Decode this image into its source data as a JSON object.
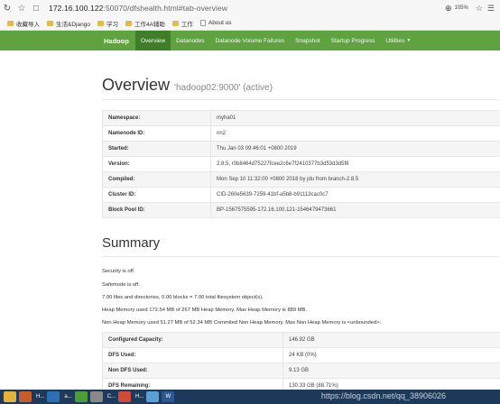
{
  "browser": {
    "url_host": "172.16.100.122",
    "url_rest": ":50070/dfshealth.html#tab-overview",
    "zoom": "105%"
  },
  "bookmarks": [
    "收藏导入",
    "生活&Django",
    "学习",
    "工作4A辅助",
    "工作",
    "About us"
  ],
  "navbar": {
    "brand": "Hadoop",
    "items": [
      "Overview",
      "Datanodes",
      "Datanode Volume Failures",
      "Snapshot",
      "Startup Progress",
      "Utilities"
    ]
  },
  "overview": {
    "title": "Overview",
    "subtitle": "'hadoop02:9000' (active)",
    "rows": [
      {
        "k": "Namespace:",
        "v": "myha01"
      },
      {
        "k": "Namenode ID:",
        "v": "nn2"
      },
      {
        "k": "Started:",
        "v": "Thu Jan 03 09:46:01 +0800 2019"
      },
      {
        "k": "Version:",
        "v": "2.8.5, r0b8464d75227fcee2c6e7f2410377b3d53d3d5f8"
      },
      {
        "k": "Compiled:",
        "v": "Mon Sep 10 11:32:00 +0800 2018 by jdu from branch-2.8.5"
      },
      {
        "k": "Cluster ID:",
        "v": "CID-260e5639-7259-41bf-a5b8-b91113cac0c7"
      },
      {
        "k": "Block Pool ID:",
        "v": "BP-1567575595-172.16.100.121-1546479473661"
      }
    ]
  },
  "summary": {
    "title": "Summary",
    "lines": [
      "Security is off.",
      "Safemode is off.",
      "7.00 files and directories, 0.00 blocks = 7.00 total filesystem object(s).",
      "Heap Memory used 172.54 MB of 267 MB Heap Memory. Max Heap Memory is 889 MB.",
      "Non Heap Memory used 51.27 MB of 52.34 MB Commited Non Heap Memory. Max Non Heap Memory is <unbounded>."
    ],
    "rows": [
      {
        "k": "Configured Capacity:",
        "v": "146.92 GB"
      },
      {
        "k": "DFS Used:",
        "v": "24 KB (0%)"
      },
      {
        "k": "Non DFS Used:",
        "v": "9.13 GB"
      },
      {
        "k": "DFS Remaining:",
        "v": "130.33 GB (88.71%)"
      }
    ]
  },
  "taskbar": {
    "labels": [
      "H...",
      "a...",
      "C...",
      "H..."
    ],
    "watermark": "https://blog.csdn.net/qq_38906026"
  }
}
